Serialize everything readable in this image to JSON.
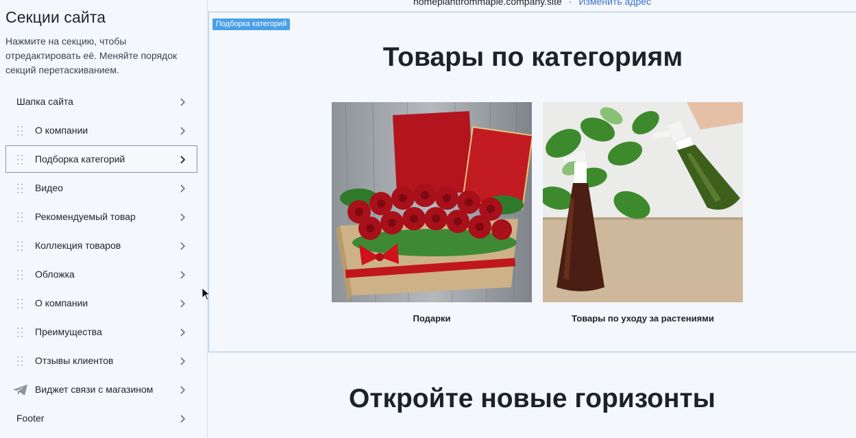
{
  "sidebar": {
    "title": "Секции сайта",
    "hint": "Нажмите на секцию, чтобы отредактировать её. Меняйте порядок секций перетаскиванием.",
    "items": [
      {
        "label": "Шапка сайта",
        "draggable": false,
        "icon": "chevron-right-icon"
      },
      {
        "label": "О компании",
        "draggable": true,
        "icon": "chevron-right-icon"
      },
      {
        "label": "Подборка категорий",
        "draggable": true,
        "active": true,
        "icon": "chevron-right-icon"
      },
      {
        "label": "Видео",
        "draggable": true,
        "icon": "chevron-right-icon"
      },
      {
        "label": "Рекомендуемый товар",
        "draggable": true,
        "icon": "chevron-right-icon"
      },
      {
        "label": "Коллекция товаров",
        "draggable": true,
        "icon": "chevron-right-icon"
      },
      {
        "label": "Обложка",
        "draggable": true,
        "icon": "chevron-right-icon"
      },
      {
        "label": "О компании",
        "draggable": true,
        "icon": "chevron-right-icon"
      },
      {
        "label": "Преимущества",
        "draggable": true,
        "icon": "chevron-right-icon"
      },
      {
        "label": "Отзывы клиентов",
        "draggable": true,
        "icon": "chevron-right-icon"
      },
      {
        "label": "Виджет связи с магазином",
        "draggable": false,
        "leading_icon": "telegram-plane-icon",
        "icon": "chevron-right-icon"
      },
      {
        "label": "Footer",
        "draggable": false,
        "icon": "chevron-right-icon"
      }
    ]
  },
  "preview": {
    "address": "homeplantfrommaple.company.site",
    "separator": "·",
    "change_address": "Изменить адрес",
    "selected_badge": "Подборка категорий",
    "categories_title": "Товары по категориям",
    "categories": [
      {
        "caption": "Подарки",
        "image": "gift-box-roses-photo"
      },
      {
        "caption": "Товары по уходу за растениями",
        "image": "plant-spray-bottles-photo"
      }
    ],
    "next_section_title": "Откройте новые горизонты"
  },
  "colors": {
    "accent": "#3b73d1",
    "badge": "#4a9fe8",
    "selection_border": "#9cc3ea",
    "background": "#f4f7fb"
  }
}
